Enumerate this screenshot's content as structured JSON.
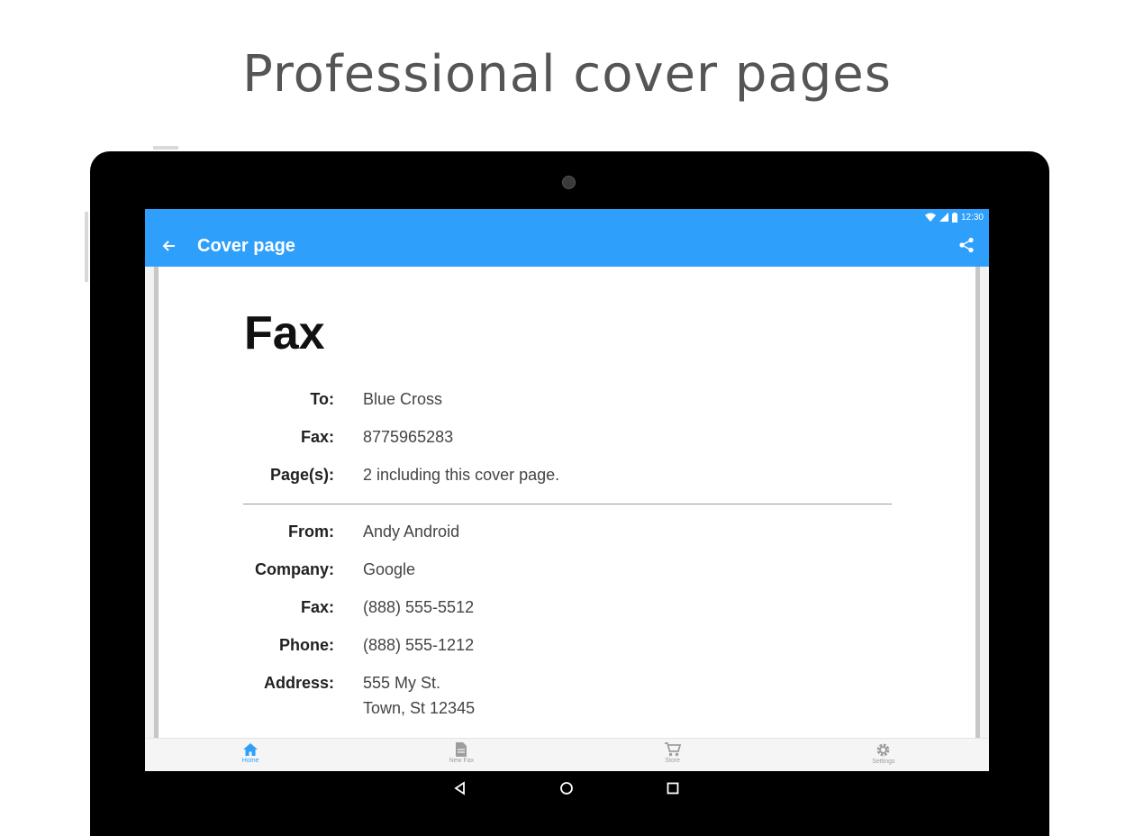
{
  "headline": "Professional cover pages",
  "status_bar": {
    "time": "12:30"
  },
  "app_bar": {
    "title": "Cover page"
  },
  "cover": {
    "title": "Fax",
    "recipient": [
      {
        "label": "To:",
        "value": "Blue Cross"
      },
      {
        "label": "Fax:",
        "value": "8775965283"
      },
      {
        "label": "Page(s):",
        "value": "2 including this cover page."
      }
    ],
    "sender": [
      {
        "label": "From:",
        "value": "Andy Android"
      },
      {
        "label": "Company:",
        "value": "Google"
      },
      {
        "label": "Fax:",
        "value": "(888) 555-5512"
      },
      {
        "label": "Phone:",
        "value": "(888) 555-1212"
      },
      {
        "label": "Address:",
        "value": "555 My St.",
        "value2": "Town, St 12345"
      }
    ]
  },
  "bottom_nav": {
    "items": [
      {
        "label": "Home",
        "icon": "home-icon",
        "active": true
      },
      {
        "label": "New Fax",
        "icon": "document-icon",
        "active": false
      },
      {
        "label": "Store",
        "icon": "cart-icon",
        "active": false
      },
      {
        "label": "Settings",
        "icon": "gear-icon",
        "active": false
      }
    ]
  },
  "colors": {
    "accent": "#2ea0fb",
    "headline": "#555555"
  }
}
